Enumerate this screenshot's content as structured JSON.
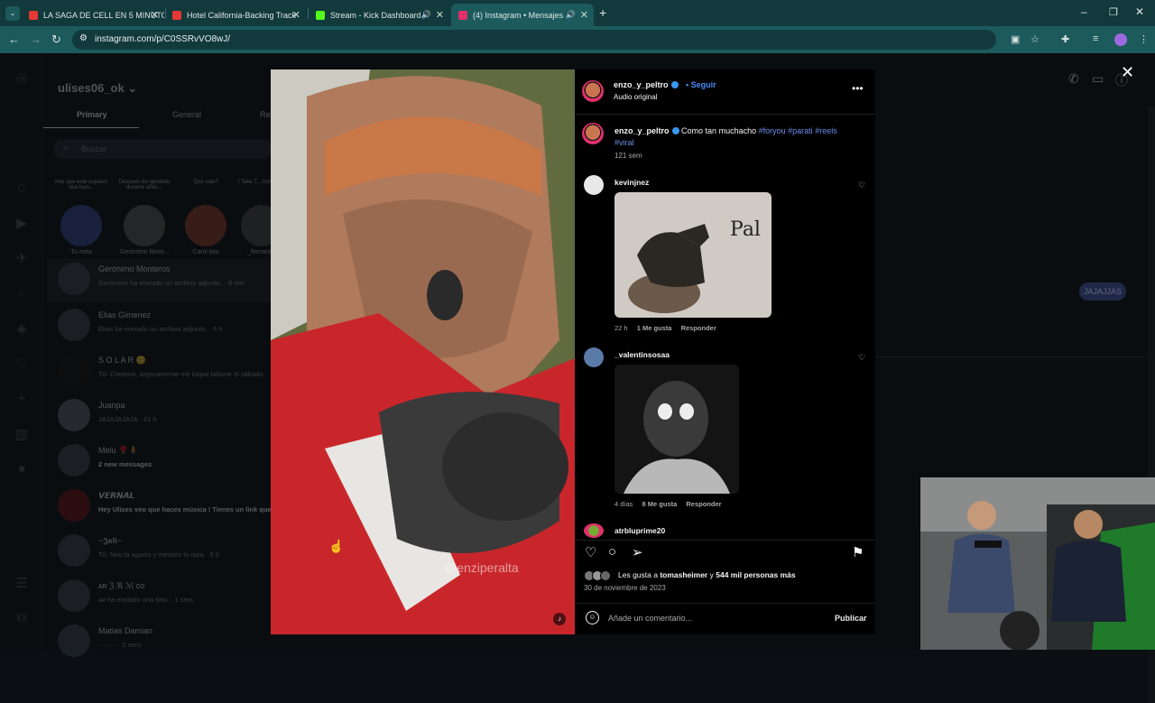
{
  "browser": {
    "tabs": [
      {
        "title": "LA SAGA DE CELL EN 5 MINUTO",
        "favicon_color": "#e53935"
      },
      {
        "title": "Hotel California-Backing Track",
        "favicon_color": "#e53935"
      },
      {
        "title": "Stream - Kick Dashboard",
        "favicon_color": "#53fc18"
      },
      {
        "title": "(4) Instagram • Mensajes",
        "favicon_color": "#e1306c"
      }
    ],
    "url": "instagram.com/p/C0SSRvVO8wJ/"
  },
  "dm": {
    "username": "ulises06_ok",
    "tabs": [
      "Primary",
      "General",
      "Re"
    ],
    "search_placeholder": "Buscar",
    "stories": [
      {
        "note": "Haz que este espacio sea tuyo...",
        "name": "Tu nota"
      },
      {
        "note": "Después de apiolarlo durante años...",
        "name": "Gerónimo Mont..."
      },
      {
        "note": "Que sale?",
        "name": "Cami two"
      },
      {
        "note": "I Take T... Amy Wi...",
        "name": "_fernande"
      }
    ],
    "conversations": [
      {
        "name": "Gerónimo Monteros",
        "preview": "Gerónimo ha enviado un archivo adjunto. · 8 min"
      },
      {
        "name": "Elias Gimenez",
        "preview": "Elias ha enviado un archivo adjunto. · 6 h"
      },
      {
        "name": "S O L A R 😊",
        "preview": "Tú: Chetooo, seguramente me toque laburar el sábado"
      },
      {
        "name": "Juanpa",
        "preview": "JAJAJAJAJA · 21 h"
      },
      {
        "name": "Melu 🌹🧍",
        "preview": "2 new messages"
      },
      {
        "name": "𝙑𝙀𝙍𝙉𝘼𝙇",
        "preview": "Hey Ulises veo que haces música ! Tienes un link que"
      },
      {
        "name": "~𝕵𝖚𝖑𝖎~",
        "preview": "Tú: Noo la agarro y mestizo la raza · 5 d"
      },
      {
        "name": "ᴀʀ ℨ ℜ ℳ co",
        "preview": "ᴀʀ ha enviado una foto. · 1 sem"
      },
      {
        "name": "Matias Damian",
        "preview": "········ · 2 sem"
      }
    ],
    "sent_bubble": "JAJAJJAS"
  },
  "post": {
    "author": "enzo_y_peltro",
    "follow": "Seguir",
    "audio": "Audio original",
    "caption_text": "Como tan muchacho",
    "hashtags": [
      "#foryou",
      "#parati",
      "#reels",
      "#viral"
    ],
    "caption_time": "121 sem",
    "watermark": "@enziperalta",
    "comments": [
      {
        "user": "kevinjnez",
        "time": "22 h",
        "likes": "1 Me gusta",
        "reply": "Responder",
        "image_text": "Pal"
      },
      {
        "user": "_valentinsosaa",
        "time": "4 días",
        "likes": "8 Me gusta",
        "reply": "Responder"
      },
      {
        "user": "atrbluprime20"
      }
    ],
    "likes_prefix": "Les gusta a",
    "likes_user": "tomasheimer",
    "likes_suffix": "y",
    "likes_count": "544 mil personas más",
    "date": "30 de noviembre de 2023",
    "comment_placeholder": "Añade un comentario...",
    "publish": "Publicar"
  },
  "colors": {
    "accent_blue": "#4c8bf5",
    "hashtag": "#6e8eea",
    "tab_bg": "#12393b",
    "toolbar_bg": "#1c5a5c"
  }
}
